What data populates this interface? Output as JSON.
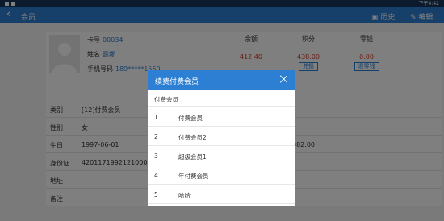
{
  "status_bar": {
    "time": "下午4:42"
  },
  "app_bar": {
    "title": "会员",
    "history_label": "历史",
    "edit_label": "编辑"
  },
  "member": {
    "card_label": "卡号",
    "card_no": "00034",
    "name_label": "姓名",
    "name": "露娜",
    "phone_label": "手机号码",
    "phone": "189*****1550",
    "balance_label": "余额",
    "balance": "412.40",
    "points_label": "积分",
    "points": "438.00",
    "exchange_label": "兑换",
    "change_label": "零钱",
    "change": "0.00",
    "refund_change_label": "退零钱"
  },
  "details": [
    {
      "label": "类别",
      "value": "[12]付费会员",
      "extra": ""
    },
    {
      "label": "性别",
      "value": "女",
      "extra": ""
    },
    {
      "label": "生日",
      "value": "1997-06-01",
      "extra": "982.00"
    },
    {
      "label": "身份证",
      "value": "42011719921210000",
      "extra": ""
    },
    {
      "label": "地址",
      "value": "",
      "extra": ""
    },
    {
      "label": "备注",
      "value": "",
      "extra": ""
    }
  ],
  "modal": {
    "title": "续费付费会员",
    "subtitle": "付费会员",
    "items": [
      {
        "no": "1",
        "name": "付费会员"
      },
      {
        "no": "2",
        "name": "付费会员2"
      },
      {
        "no": "3",
        "name": "超级会员1"
      },
      {
        "no": "4",
        "name": "年付费会员"
      },
      {
        "no": "5",
        "name": "哈哈"
      }
    ]
  },
  "colors": {
    "primary": "#2d7fd3",
    "status_bar": "#17365a",
    "value_red": "#d23a2a"
  },
  "icons": [
    "back-arrow-icon",
    "history-icon",
    "edit-icon",
    "close-icon",
    "avatar-placeholder-icon"
  ]
}
